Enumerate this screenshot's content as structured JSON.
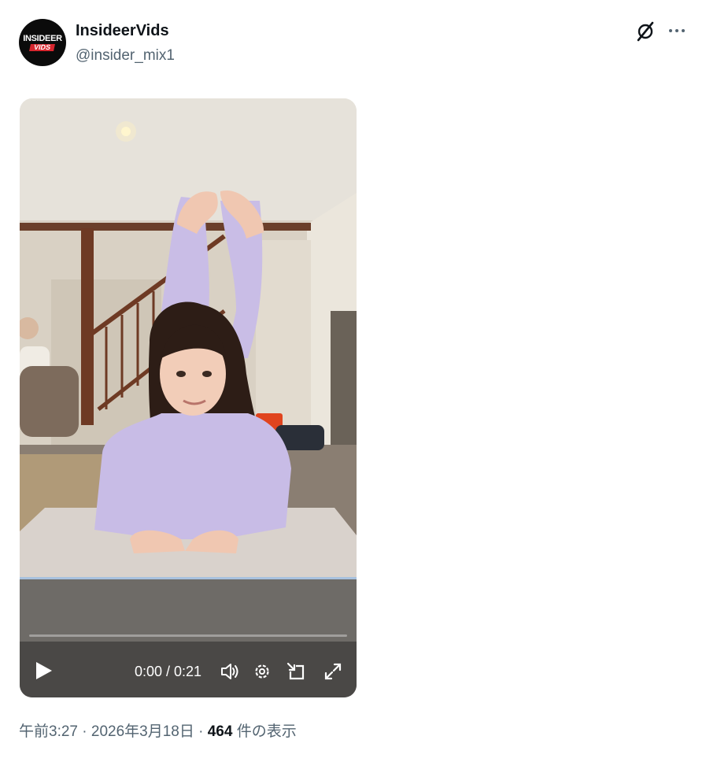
{
  "author": {
    "avatar_line1": "INSIDEER",
    "avatar_line2": "VIDS",
    "display_name": "InsideerVids",
    "handle": "@insider_mix1"
  },
  "header_icons": [
    "grok-icon",
    "more-icon"
  ],
  "video": {
    "time": "0:00 / 0:21",
    "progress": 0,
    "controls": [
      "play-icon",
      "volume-icon",
      "settings-icon",
      "pip-icon",
      "fullscreen-icon"
    ]
  },
  "meta": {
    "time": "午前3:27",
    "sep1": " · ",
    "date": "2026年3月18日",
    "sep2": " · ",
    "views_count": "464",
    "views_label": " 件の表示"
  }
}
